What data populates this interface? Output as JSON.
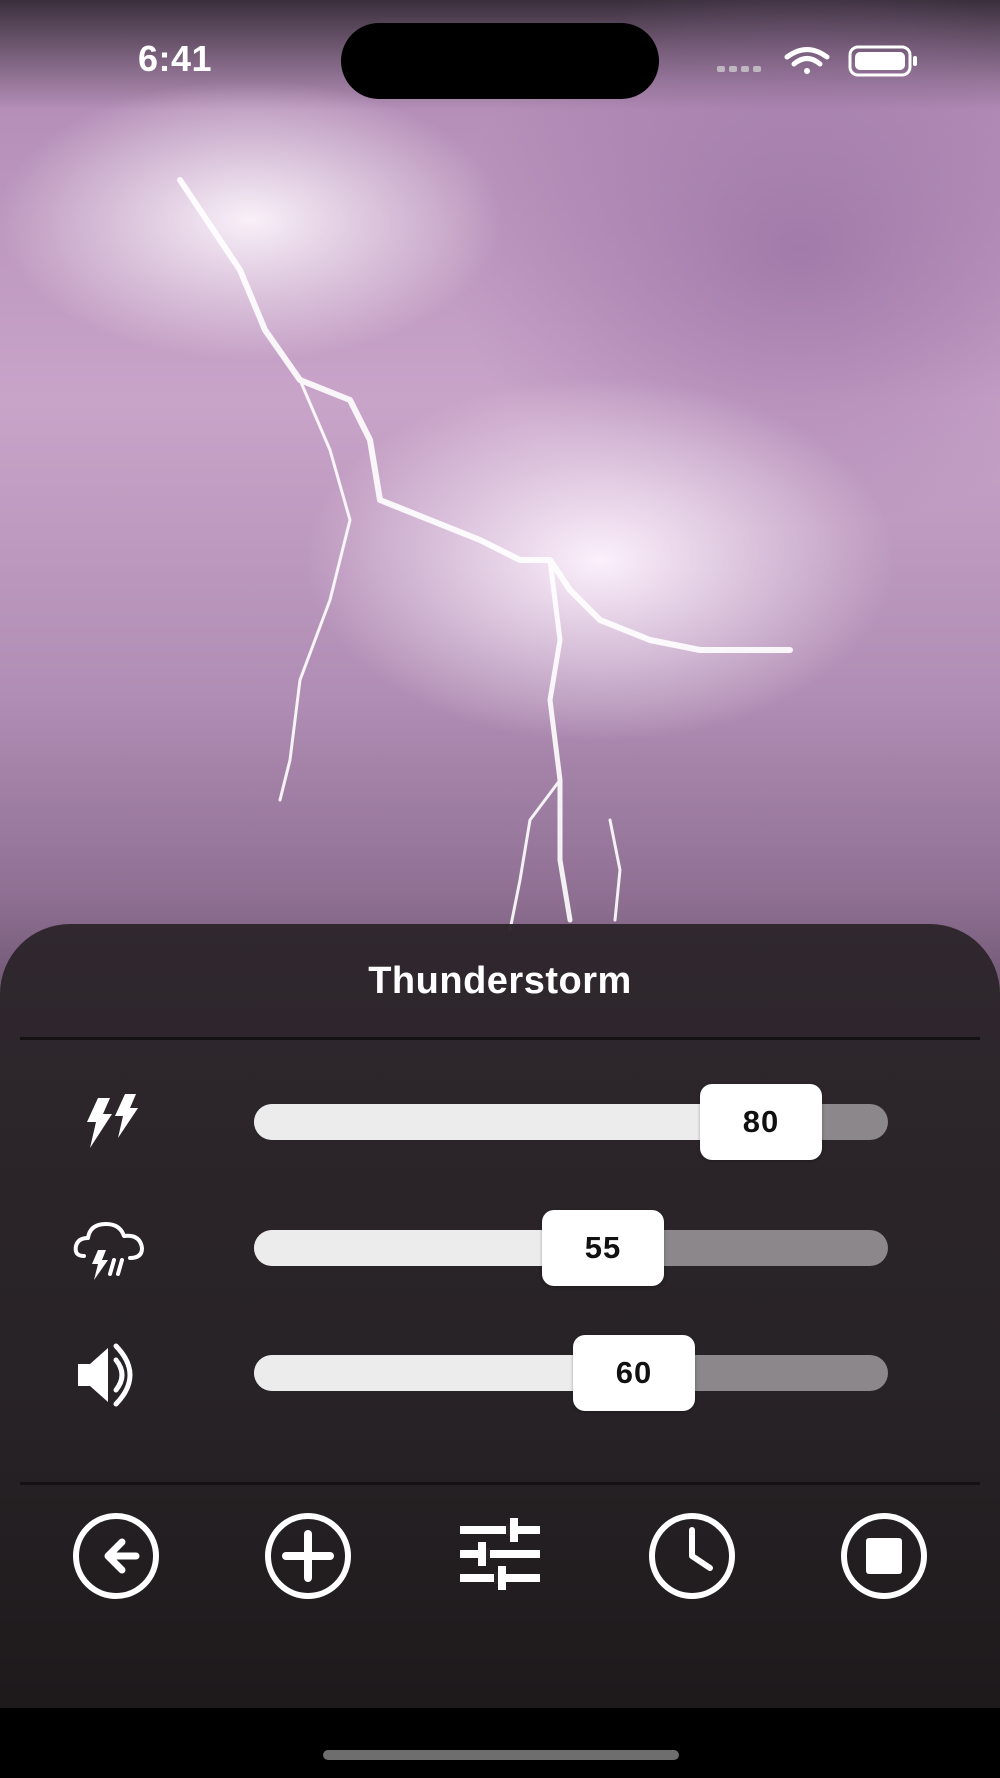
{
  "status_bar": {
    "time": "6:41"
  },
  "panel": {
    "title": "Thunderstorm",
    "sliders": [
      {
        "icon": "thunder-icon",
        "value": 80,
        "label": "80"
      },
      {
        "icon": "rain-cloud-icon",
        "value": 55,
        "label": "55"
      },
      {
        "icon": "volume-icon",
        "value": 60,
        "label": "60"
      }
    ],
    "buttons": [
      {
        "icon": "back-arrow-icon"
      },
      {
        "icon": "add-icon"
      },
      {
        "icon": "sliders-icon"
      },
      {
        "icon": "clock-icon"
      },
      {
        "icon": "stop-icon"
      }
    ]
  },
  "colors": {
    "panel_bg": "#2c252a",
    "track_filled": "#ececec",
    "track_empty": "#8b878a",
    "thumb": "#ffffff"
  }
}
